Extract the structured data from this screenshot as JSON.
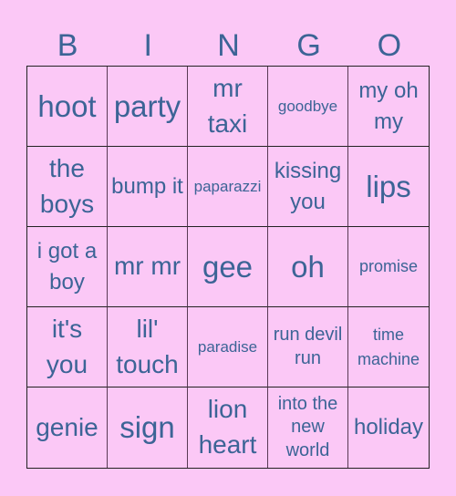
{
  "title_letters": [
    "B",
    "I",
    "N",
    "G",
    "O"
  ],
  "colors": {
    "background": "#fbc8f6",
    "text": "#3c6496",
    "grid_line": "#222222"
  },
  "cells": [
    {
      "text": "hoot",
      "size": "xl"
    },
    {
      "text": "party",
      "size": "xl"
    },
    {
      "text": "mr taxi",
      "size": "l"
    },
    {
      "text": "goodbye",
      "size": "t"
    },
    {
      "text": "my oh my",
      "size": "m"
    },
    {
      "text": "the boys",
      "size": "l"
    },
    {
      "text": "bump it",
      "size": "m"
    },
    {
      "text": "paparazzi",
      "size": "t"
    },
    {
      "text": "kissing you",
      "size": "m"
    },
    {
      "text": "lips",
      "size": "xl"
    },
    {
      "text": "i got a boy",
      "size": "m"
    },
    {
      "text": "mr mr",
      "size": "l"
    },
    {
      "text": "gee",
      "size": "xl"
    },
    {
      "text": "oh",
      "size": "xl"
    },
    {
      "text": "promise",
      "size": "xs"
    },
    {
      "text": "it's you",
      "size": "l"
    },
    {
      "text": "lil' touch",
      "size": "l"
    },
    {
      "text": "paradise",
      "size": "t"
    },
    {
      "text": "run devil run",
      "size": "s"
    },
    {
      "text": "time machine",
      "size": "xs"
    },
    {
      "text": "genie",
      "size": "l"
    },
    {
      "text": "sign",
      "size": "xl"
    },
    {
      "text": "lion heart",
      "size": "l"
    },
    {
      "text": "into the new world",
      "size": "s"
    },
    {
      "text": "holiday",
      "size": "m"
    }
  ]
}
